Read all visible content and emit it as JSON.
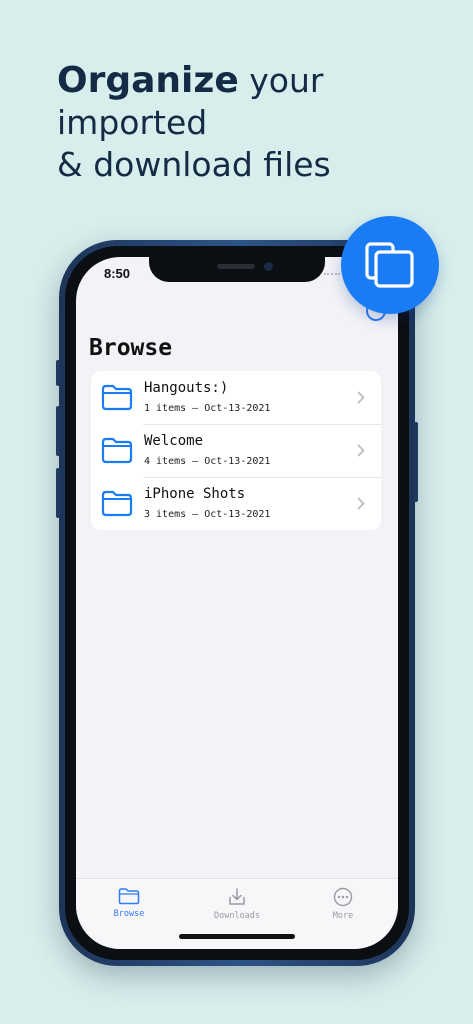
{
  "headline": {
    "bold": "Organize",
    "line1_rest": " your",
    "line2": "imported",
    "line3": "& download files"
  },
  "status_bar": {
    "time": "8:50"
  },
  "browse": {
    "title": "Browse",
    "folders": [
      {
        "name": "Hangouts:)",
        "meta": "1 items – Oct-13-2021"
      },
      {
        "name": "Welcome",
        "meta": "4 items – Oct-13-2021"
      },
      {
        "name": "iPhone Shots",
        "meta": "3 items – Oct-13-2021"
      }
    ]
  },
  "tabbar": {
    "tabs": [
      {
        "label": "Browse",
        "icon": "folder-icon",
        "active": true
      },
      {
        "label": "Downloads",
        "icon": "download-tray-icon",
        "active": false
      },
      {
        "label": "More",
        "icon": "more-ellipsis-icon",
        "active": false
      }
    ]
  },
  "colors": {
    "background": "#d8eeec",
    "headline": "#152a44",
    "accent": "#1a7cf5",
    "phone_frame": "#2d5488"
  },
  "icons": {
    "fab": "copy-files-icon",
    "row_leading": "folder-icon",
    "row_trailing": "chevron-right-icon",
    "nav_add": "add-circle-icon"
  }
}
